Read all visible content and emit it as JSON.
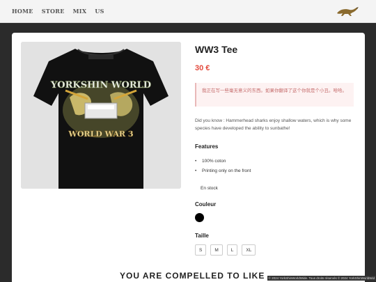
{
  "nav": {
    "items": [
      "HOME",
      "STORE",
      "MIX",
      "US"
    ],
    "logo_icon": "leaping-animal-logo"
  },
  "product": {
    "title": "WW3 Tee",
    "price": "30 €",
    "notice": "我正在写一些毫无意义的东西。如果你翻译了这个你就是个小丑。哈哈。",
    "description": "Did you know : Hammerhead sharks enjoy shallow waters, which is why some species have developed the ability to sunbathe!",
    "features_title": "Features",
    "features": [
      "100% coton",
      "Printing only on the front"
    ],
    "stock": "En stock",
    "color_title": "Couleur",
    "colors": [
      "#000000"
    ],
    "size_title": "Taille",
    "sizes": [
      "S",
      "M",
      "L",
      "XL"
    ],
    "image": {
      "print_top": "YORKSHIN WORLD",
      "print_bottom": "WORLD WAR 3"
    }
  },
  "footer": {
    "marquee": "YOU ARE COMPELLED TO LIKE",
    "copyright": "© 2024 YorkShinWorldWide. Tous droits réservés © 2024 YorkShinWorldWid"
  }
}
